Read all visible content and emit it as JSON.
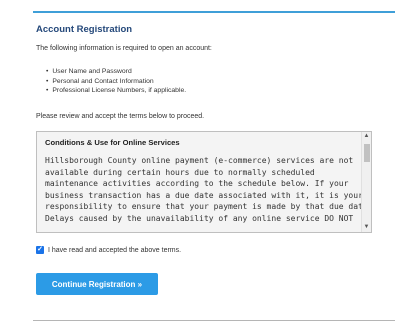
{
  "section": {
    "heading": "Account Registration",
    "intro": "The following information is required to open an account:",
    "requirements": [
      "User Name and Password",
      "Personal and Contact Information",
      "Professional License Numbers, if applicable."
    ],
    "review_text": "Please review and accept the terms below to proceed."
  },
  "terms": {
    "title": "Conditions & Use for Online Services",
    "lines": [
      "Hillsborough County online payment (e-commerce) services are not",
      "available during certain hours due to normally scheduled",
      "maintenance activities according to the schedule below. If your",
      "business transaction has a due date associated with it, it is your",
      "responsibility to ensure that your payment is made by that due date.",
      "Delays caused by the unavailability of any online service DO NOT"
    ]
  },
  "agreement": {
    "checked": true,
    "label": "I have read and accepted the above terms."
  },
  "actions": {
    "continue_label": "Continue Registration »"
  },
  "colors": {
    "accent": "#3f9fd8",
    "heading": "#24487a",
    "button": "#2c9be6",
    "checkbox": "#1a73e8"
  },
  "icons": {
    "scroll_up": "scroll-up-arrow-icon",
    "scroll_down": "scroll-down-arrow-icon",
    "checkbox": "checkmark-icon"
  }
}
